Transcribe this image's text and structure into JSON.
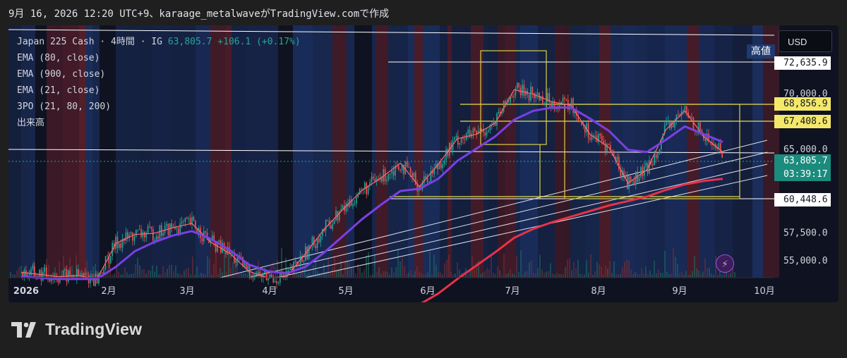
{
  "header_text": "9月 16, 2026 12:20 UTC+9、karaage_metalwaveがTradingView.comで作成",
  "legend": {
    "symbol": "Japan 225 Cash · 4時間 · IG",
    "price": "63,805.7",
    "change": "+106.1 (+0.17%)",
    "indicators": [
      "EMA (80, close)",
      "EMA (900, close)",
      "EMA (21, close)",
      "3PO (21, 80, 200)",
      "出来高"
    ]
  },
  "currency_button": "USD",
  "high_label": "高値",
  "price_labels": {
    "high": "72,635.9",
    "box_top": "68,856.9",
    "box_mid": "67,408.6",
    "current": "63,805.7",
    "countdown": "03:39:17",
    "low": "60,448.6"
  },
  "logo_text": "TradingView",
  "colors": {
    "up": "#26a69a",
    "down": "#ef5350",
    "ema21": "#ff6b6b",
    "ema80": "#7b3fe4",
    "ema900": "#e8324a",
    "box": "#d8cf4a",
    "bg_blue": "#1c3266",
    "bg_red": "#5a1f2c",
    "current_label_bg": "#1b8b7d"
  },
  "chart_data": {
    "type": "line",
    "title": "Japan 225 Cash · 4時間 · IG",
    "xlabel": "",
    "ylabel": "",
    "x_ticks": [
      "2026",
      "2月",
      "3月",
      "4月",
      "5月",
      "6月",
      "7月",
      "8月",
      "9月",
      "10月"
    ],
    "y_ticks": [
      "55,000.0",
      "57,500.0",
      "65,000.0",
      "70,000.0"
    ],
    "ylim": [
      54000,
      74000
    ],
    "grid": false,
    "x": [
      "2026-01-01",
      "2026-01-08",
      "2026-01-15",
      "2026-01-22",
      "2026-01-29",
      "2026-02-05",
      "2026-02-12",
      "2026-02-19",
      "2026-02-26",
      "2026-03-05",
      "2026-03-12",
      "2026-03-19",
      "2026-03-26",
      "2026-04-02",
      "2026-04-09",
      "2026-04-16",
      "2026-04-23",
      "2026-04-30",
      "2026-05-07",
      "2026-05-14",
      "2026-05-21",
      "2026-05-28",
      "2026-06-04",
      "2026-06-11",
      "2026-06-18",
      "2026-06-25",
      "2026-07-02",
      "2026-07-09",
      "2026-07-16",
      "2026-07-23",
      "2026-07-30",
      "2026-08-06",
      "2026-08-13",
      "2026-08-20",
      "2026-08-27",
      "2026-09-03",
      "2026-09-10",
      "2026-09-16"
    ],
    "series": [
      {
        "name": "EMA (21, close)",
        "values": [
          53900,
          53700,
          53500,
          53600,
          53300,
          56500,
          57300,
          57400,
          57900,
          58300,
          56600,
          55600,
          54000,
          53400,
          53500,
          55600,
          57800,
          59600,
          61300,
          62400,
          63700,
          61600,
          63600,
          65900,
          66300,
          67300,
          70300,
          69900,
          69200,
          68900,
          66300,
          65100,
          61900,
          63100,
          66700,
          68400,
          66100,
          64700
        ]
      },
      {
        "name": "EMA (80, close)",
        "values": [
          53500,
          53400,
          53300,
          53300,
          53300,
          54400,
          55800,
          56600,
          57200,
          57600,
          56900,
          55900,
          54600,
          54000,
          53800,
          54400,
          55700,
          57200,
          58700,
          60000,
          61200,
          61400,
          62300,
          63900,
          65000,
          66100,
          67600,
          68400,
          68700,
          68700,
          67700,
          66600,
          64900,
          64700,
          65800,
          67000,
          66300,
          65600
        ]
      },
      {
        "name": "EMA (900, close)",
        "values": [
          null,
          null,
          null,
          null,
          null,
          null,
          null,
          null,
          null,
          null,
          null,
          null,
          null,
          null,
          null,
          null,
          null,
          null,
          null,
          null,
          50400,
          51000,
          52000,
          53300,
          54500,
          55700,
          57000,
          57800,
          58400,
          58900,
          59400,
          59900,
          60300,
          60700,
          61300,
          61800,
          62100,
          62300
        ]
      }
    ],
    "annotations": [
      "Current price 63,805.7",
      "High 72,635.9",
      "Box 68,856.9",
      "Box 67,408.6",
      "Low 60,448.6"
    ]
  }
}
